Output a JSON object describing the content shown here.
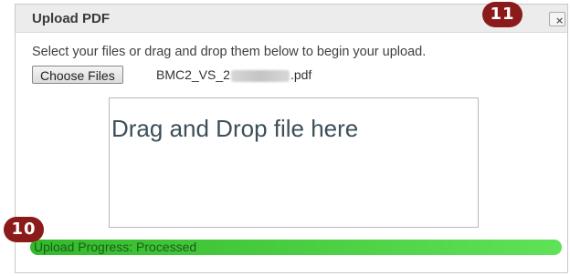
{
  "dialog": {
    "title": "Upload PDF",
    "close_label": "×",
    "instructions": "Select your files or drag and drop them below to begin your upload.",
    "choose_button_label": "Choose Files",
    "filename_prefix": "BMC2_VS_2",
    "filename_suffix": ".pdf",
    "dropzone_text": "Drag and Drop file here",
    "progress": {
      "label": "Upload Progress: Processed",
      "percent": 100
    }
  },
  "annotations": {
    "badge_close": "11",
    "badge_progress": "10"
  },
  "colors": {
    "badge": "#8b1a1a",
    "progress": "#62e55a",
    "title_bar": "#ececec"
  }
}
